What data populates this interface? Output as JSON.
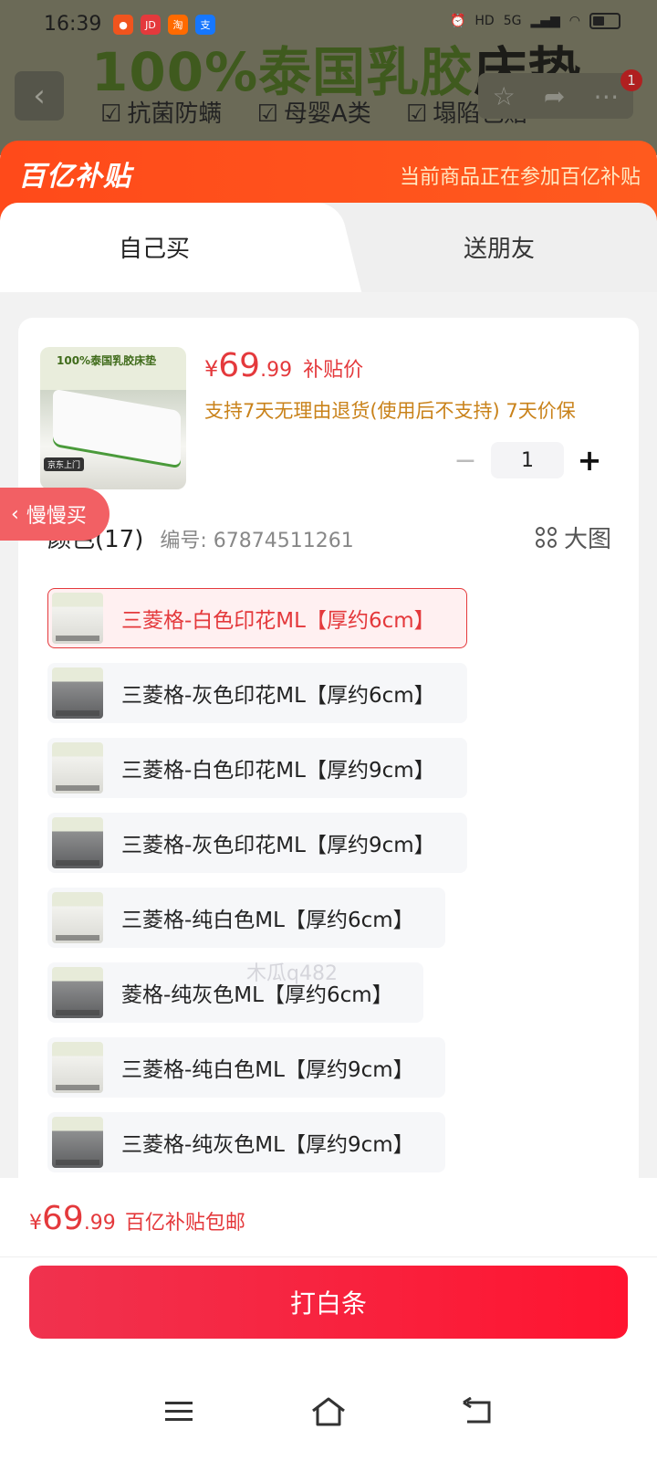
{
  "status_bar": {
    "time": "16:39",
    "apps": [
      {
        "icon": "tomato-app-icon",
        "color": "#f0541e",
        "glyph": "●"
      },
      {
        "icon": "jd-app-icon",
        "color": "#e4393c",
        "glyph": "JD"
      },
      {
        "icon": "taobao-app-icon",
        "color": "#ff6a00",
        "glyph": "淘"
      },
      {
        "icon": "alipay-app-icon",
        "color": "#1677ff",
        "glyph": "支"
      }
    ],
    "network_label": "5G",
    "hd_label": "HD"
  },
  "background": {
    "banner_prefix": "100%泰国乳胶",
    "banner_suffix": "床垫",
    "features": [
      "抗菌防螨",
      "母婴A类",
      "塌陷包赔"
    ],
    "notification_count": "1"
  },
  "subsidy": {
    "logo": "百亿补贴",
    "note": "当前商品正在参加百亿补贴"
  },
  "tabs": [
    {
      "label": "自己买",
      "active": true
    },
    {
      "label": "送朋友",
      "active": false
    }
  ],
  "product": {
    "thumb_title": "100%泰国乳胶床垫",
    "thumb_tag": "京东上门",
    "price_yen": "¥",
    "price_int": "69",
    "price_dec": ".99",
    "price_tag": "补贴价",
    "policy": "支持7天无理由退货(使用后不支持)  7天价保",
    "quantity": "1",
    "minus": "−",
    "plus": "+"
  },
  "spec": {
    "title": "颜色(17)",
    "code": "编号: 67874511261",
    "big_image_label": "大图",
    "options": [
      {
        "label": "三菱格-白色印花ML【厚约6cm】",
        "selected": true,
        "tone": "white"
      },
      {
        "label": "三菱格-灰色印花ML【厚约6cm】",
        "selected": false,
        "tone": "grey"
      },
      {
        "label": "三菱格-白色印花ML【厚约9cm】",
        "selected": false,
        "tone": "white"
      },
      {
        "label": "三菱格-灰色印花ML【厚约9cm】",
        "selected": false,
        "tone": "grey"
      },
      {
        "label": "三菱格-纯白色ML【厚约6cm】",
        "selected": false,
        "tone": "white"
      },
      {
        "label": "菱格-纯灰色ML【厚约6cm】",
        "selected": false,
        "tone": "grey"
      },
      {
        "label": "三菱格-纯白色ML【厚约9cm】",
        "selected": false,
        "tone": "white"
      },
      {
        "label": "三菱格-纯灰色ML【厚约9cm】",
        "selected": false,
        "tone": "grey"
      }
    ]
  },
  "slow_buy": {
    "label": "慢慢买"
  },
  "watermark": "木瓜q482",
  "footer": {
    "price_yen": "¥",
    "price_int": "69",
    "price_dec": ".99",
    "price_tag": "百亿补贴包邮",
    "buy_label": "打白条"
  },
  "nav": {
    "menu_icon": "menu-icon",
    "home_icon": "home-icon",
    "back_icon": "back-icon"
  },
  "colors": {
    "accent_red": "#e4393c",
    "subsidy_orange": "#ff4a1a",
    "policy_gold": "#c9821a"
  }
}
